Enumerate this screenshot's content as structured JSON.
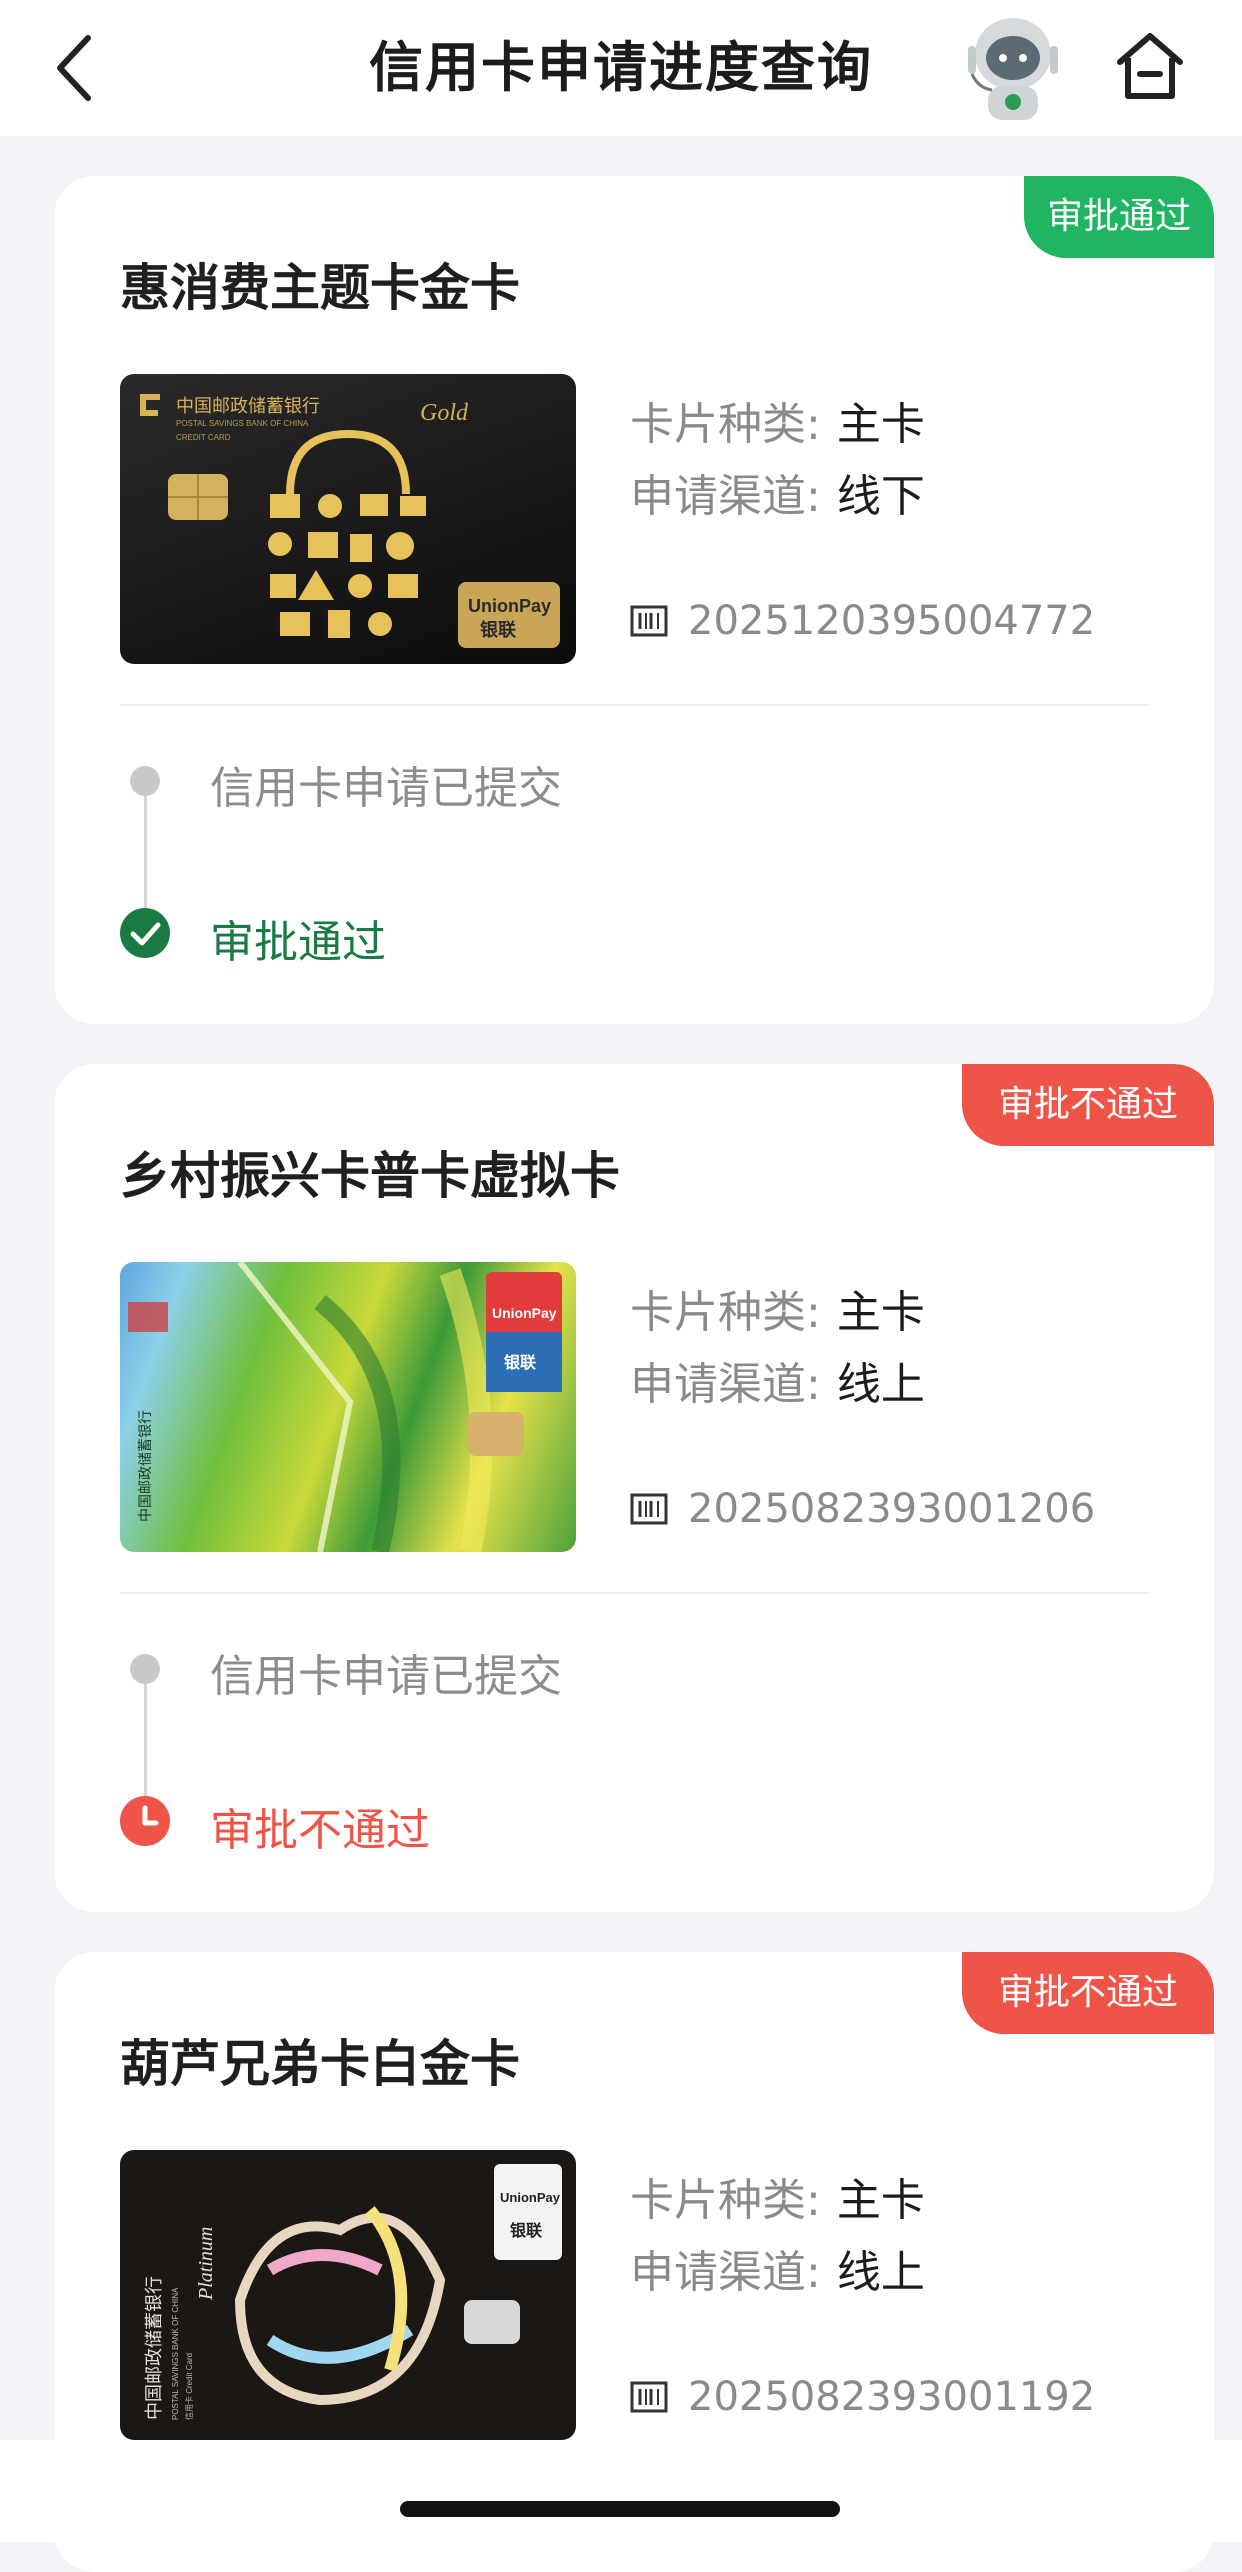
{
  "header": {
    "title": "信用卡申请进度查询",
    "back_icon": "chevron-left-icon",
    "assistant_icon": "robot-assistant-icon",
    "home_icon": "home-icon"
  },
  "labels": {
    "card_type": "卡片种类:",
    "channel": "申请渠道:"
  },
  "cards": [
    {
      "name": "惠消费主题卡金卡",
      "status": "审批通过",
      "status_color": "#1fb563",
      "card_type": "主卡",
      "channel": "线下",
      "serial": "2025120395004772",
      "step1": "信用卡申请已提交",
      "step2": "审批通过",
      "step2_color": "#1a7a44",
      "card_art": {
        "bank": "中国邮政储蓄银行",
        "bank_en": "POSTAL SAVINGS BANK OF CHINA",
        "subtitle": "CREDIT CARD",
        "tier": "Gold",
        "network": "UnionPay",
        "network_cn": "银联"
      }
    },
    {
      "name": "乡村振兴卡普卡虚拟卡",
      "status": "审批不通过",
      "status_color": "#ee5448",
      "card_type": "主卡",
      "channel": "线上",
      "serial": "2025082393001206",
      "step1": "信用卡申请已提交",
      "step2": "审批不通过",
      "step2_color": "#ee5448",
      "card_art": {
        "bank": "中国邮政储蓄银行",
        "network": "UnionPay",
        "network_cn": "银联"
      }
    },
    {
      "name": "葫芦兄弟卡白金卡",
      "status": "审批不通过",
      "status_color": "#ee5448",
      "card_type": "主卡",
      "channel": "线上",
      "serial": "2025082393001192",
      "card_art": {
        "bank": "中国邮政储蓄银行",
        "bank_en": "POSTAL SAVINGS BANK OF CHINA",
        "subtitle": "信用卡 Credit Card",
        "tier": "Platinum",
        "network": "UnionPay",
        "network_cn": "银联"
      }
    }
  ]
}
